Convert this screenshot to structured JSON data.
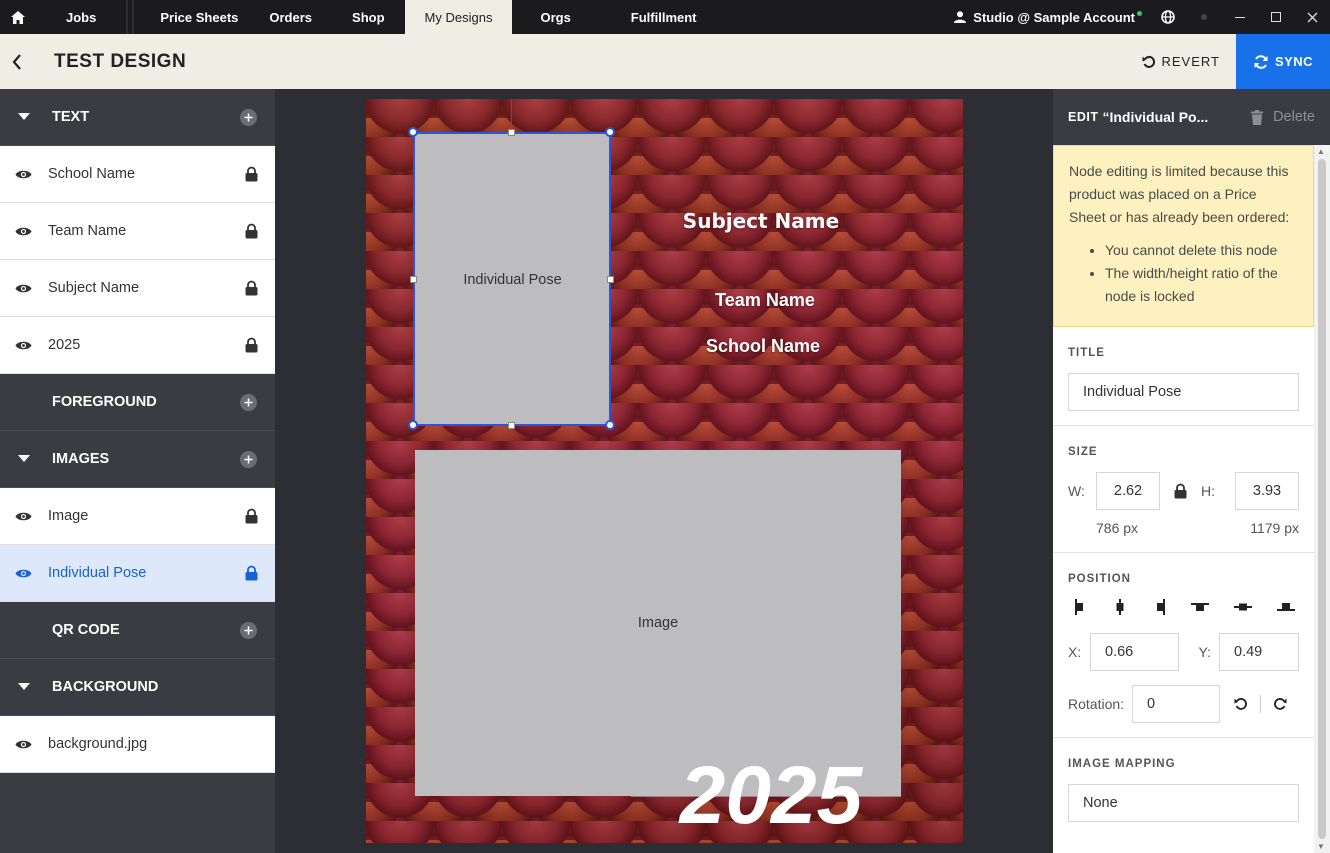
{
  "nav": {
    "tabs": [
      {
        "label": "Jobs"
      },
      {
        "label": "Price Sheets"
      },
      {
        "label": "Orders"
      },
      {
        "label": "Shop"
      },
      {
        "label": "My Designs"
      },
      {
        "label": "Orgs"
      },
      {
        "label": "Fulfillment"
      }
    ],
    "account": "Studio @ Sample Account"
  },
  "header": {
    "title": "TEST DESIGN",
    "revert_label": "REVERT",
    "sync_label": "SYNC"
  },
  "layers": {
    "text_section": "TEXT",
    "text_items": [
      "School Name",
      "Team Name",
      "Subject Name",
      "2025"
    ],
    "foreground_section": "FOREGROUND",
    "images_section": "IMAGES",
    "image_items": [
      "Image",
      "Individual Pose"
    ],
    "qr_section": "QR CODE",
    "background_section": "BACKGROUND",
    "background_items": [
      "background.jpg"
    ]
  },
  "canvas": {
    "pose_label": "Individual Pose",
    "image_label": "Image",
    "subject_text": "Subject Name",
    "team_text": "Team Name",
    "school_text": "School Name",
    "year_text": "2025"
  },
  "editor": {
    "edit_prefix": "EDIT",
    "edit_name": "“Individual Po...",
    "delete_label": "Delete",
    "warning_intro": "Node editing is limited because this product was placed on a Price Sheet or has already been ordered:",
    "warning_items": [
      "You cannot delete this node",
      "The width/height ratio of the node is locked"
    ],
    "title_label": "TITLE",
    "title_value": "Individual Pose",
    "size_label": "SIZE",
    "w_label": "W:",
    "w_value": "2.62",
    "h_label": "H:",
    "h_value": "3.93",
    "w_px": "786 px",
    "h_px": "1179 px",
    "position_label": "POSITION",
    "x_label": "X:",
    "x_value": "0.66",
    "y_label": "Y:",
    "y_value": "0.49",
    "rotation_label": "Rotation:",
    "rotation_value": "0",
    "mapping_label": "IMAGE MAPPING",
    "mapping_value": "None"
  },
  "colors": {
    "accent": "#1871e8",
    "selection": "#2f55d4",
    "warning_bg": "#fdf1bf"
  }
}
